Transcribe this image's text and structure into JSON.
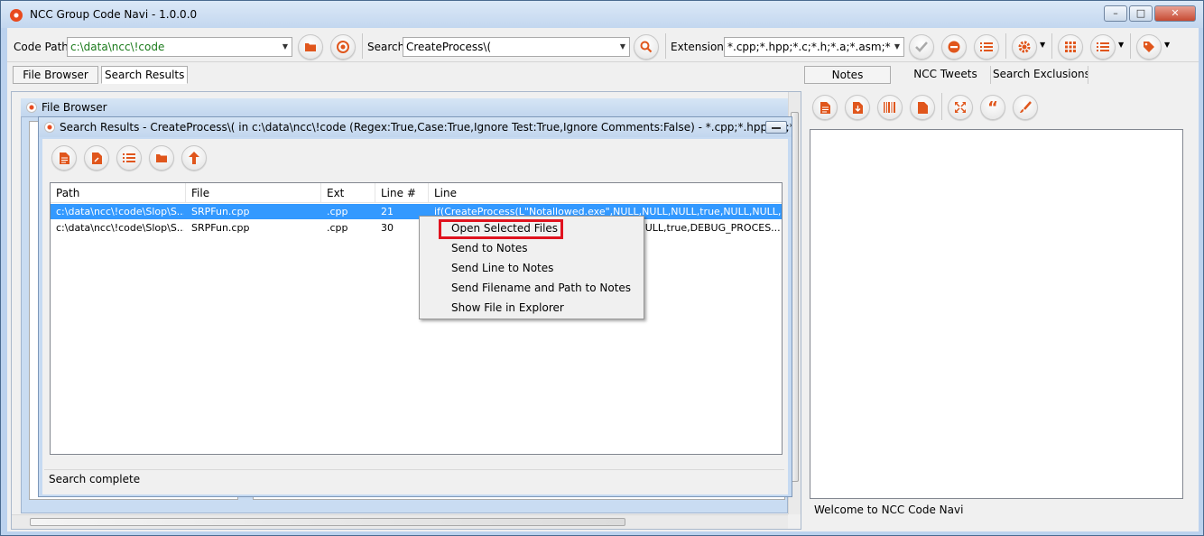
{
  "window": {
    "title": "NCC Group Code Navi - 1.0.0.0",
    "min": "–",
    "max": "□",
    "close": "✕"
  },
  "toolbar": {
    "code_path_label": "Code Path",
    "code_path_value": "c:\\data\\ncc\\!code",
    "search_label": "Search",
    "search_value": "CreateProcess\\(",
    "extensions_label": "Extensions",
    "extensions_value": "*.cpp;*.hpp;*.c;*.h;*.a;*.asm;*.mm"
  },
  "left_tabs": {
    "file_browser": "File Browser",
    "search_results": "Search Results - Cr"
  },
  "file_browser_window": {
    "title": "File Browser"
  },
  "search_window": {
    "title": "Search Results - CreateProcess\\( in c:\\data\\ncc\\!code (Regex:True,Case:True,Ignore Test:True,Ignore Comments:False) - *.cpp;*.hpp;*.c;*.h;*.a;*.a...",
    "columns": [
      "Path",
      "File",
      "Ext",
      "Line #",
      "Line"
    ],
    "rows": [
      {
        "path": "c:\\data\\ncc\\!code\\Slop\\S...",
        "file": "SRPFun.cpp",
        "ext": ".cpp",
        "line_no": "21",
        "line": "if(CreateProcess(L\"Notallowed.exe\",NULL,NULL,NULL,true,NULL,NULL,NULL,..."
      },
      {
        "path": "c:\\data\\ncc\\!code\\Slop\\S...",
        "file": "SRPFun.cpp",
        "ext": ".cpp",
        "line_no": "30",
        "line": "...NULL,true,DEBUG_PROCES..."
      }
    ],
    "status": "Search complete"
  },
  "context_menu": {
    "items": [
      "Open Selected Files",
      "Send to Notes",
      "Send Line to Notes",
      "Send Filename and Path to Notes",
      "Show File in Explorer"
    ]
  },
  "right_tabs": {
    "notes": "Notes",
    "tweets": "NCC Tweets",
    "exclusions": "Search Exclusions"
  },
  "right_status": "Welcome to NCC Code Navi",
  "colors": {
    "accent": "#e0561c",
    "selection": "#3399ff",
    "highlight": "#e0121e"
  }
}
